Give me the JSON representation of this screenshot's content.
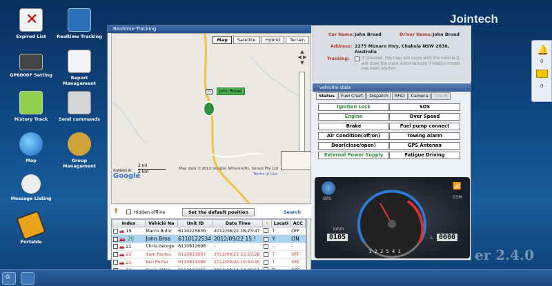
{
  "desktop": {
    "icons": [
      {
        "label": "Expired List"
      },
      {
        "label": "Realtime Tracking"
      },
      {
        "label": "GP6000F Setting"
      },
      {
        "label": "Report Management"
      },
      {
        "label": "History Track"
      },
      {
        "label": "Send commands"
      },
      {
        "label": "Map"
      },
      {
        "label": "Group Management"
      },
      {
        "label": "Message Listing"
      },
      {
        "label": "Portable"
      }
    ]
  },
  "brand": {
    "logo": "Jointech",
    "version": "er 2.4.0"
  },
  "window": {
    "title": "Realtime Tracking"
  },
  "map": {
    "tabs": [
      "Map",
      "Satellite",
      "Hybrid",
      "Terrain"
    ],
    "active_tab": "Map",
    "vehicle_label": "John Broad",
    "road_number": "21",
    "scale": [
      "2 mi",
      "2 km"
    ],
    "copyright": "Map data ©2012  Google, Whereis(R), Sensis Pty Ltd",
    "terms": "Terms of Use",
    "powered_by": "POWERED BY",
    "google": "Google"
  },
  "controls": {
    "hidden_offline": "Hidden offline",
    "set_default": "Set the default position",
    "search": "Search"
  },
  "table": {
    "headers": [
      "Index",
      "Vehicle Na",
      "Unit ID",
      "Date Time",
      "",
      "Locati",
      "ACC"
    ],
    "rows": [
      {
        "index": "19",
        "name": "Marco Bullic",
        "unit": "6110225836",
        "dt": "2012/08/22 18:23:47",
        "loc": "T",
        "acc": "OFF",
        "style": ""
      },
      {
        "index": "20",
        "name": "John Broa",
        "unit": "6110122534",
        "dt": "2012/09/22 15:!",
        "loc": "Y",
        "acc": "ON",
        "style": "sel"
      },
      {
        "index": "21",
        "name": "Chris George",
        "unit": "6110812696",
        "dt": "-",
        "loc": "-",
        "acc": "-",
        "style": ""
      },
      {
        "index": "22",
        "name": "Sam Pavlou",
        "unit": "6110813003",
        "dt": "2012/09/22 15:53:28",
        "loc": "T",
        "acc": "OFF",
        "style": "red"
      },
      {
        "index": "23",
        "name": "Ken Porter",
        "unit": "6110812589",
        "dt": "2012/09/22 15:54:30",
        "loc": "T",
        "acc": "OFF",
        "style": "red"
      },
      {
        "index": "24",
        "name": "Craig Willis",
        "unit": "6110812465",
        "dt": "2012/09/11 13:29:51",
        "loc": "T",
        "acc": "OFF",
        "style": ""
      }
    ]
  },
  "info": {
    "car_name_lbl": "Car Name:",
    "car_name": "John Broad",
    "driver_name_lbl": "Driver Name:",
    "driver_name": "John Broad",
    "address_lbl": "Address:",
    "address_1": "2275 Monaro Hwy, Chakola NSW 2630,",
    "address_2": "Australia",
    "tracking_lbl": "Tracking:",
    "tracking_note": "If Checked, the map will move with the vehicle it will draw the track automatically if history model has been started"
  },
  "vehicle_state": {
    "title": "vehichle state",
    "tabs": [
      "Status",
      "Fuel Chart",
      "Dispatch",
      "RFID",
      "Camera",
      "Tire Pr"
    ],
    "active_tab": "Status",
    "grid": [
      [
        "Ignition Lock",
        "SOS"
      ],
      [
        "Engine",
        "Over Speed"
      ],
      [
        "Brake",
        "Fuel pump connect"
      ],
      [
        "Air Condition(off/on)",
        "Towing Alarm"
      ],
      [
        "Door(close/open)",
        "GPS Antenna"
      ],
      [
        "External Power Supply",
        "Fatigue Driving"
      ]
    ],
    "green_cells": [
      "Ignition Lock",
      "Engine",
      "External Power Supply"
    ]
  },
  "dashboard": {
    "gps": "GPS",
    "gsm": "GSM",
    "kmh": "km/h",
    "speed_readout": "0105",
    "odo": "0000",
    "odo_unit": "L",
    "gears": [
      "1",
      "2",
      "2",
      "5",
      "4",
      "1"
    ]
  },
  "sidebar": {
    "counts": [
      "0",
      "0"
    ]
  },
  "colors": {
    "title_blue": "#2f5f9c",
    "status_green": "#2e8b3a",
    "label_red": "#b03a2e"
  }
}
